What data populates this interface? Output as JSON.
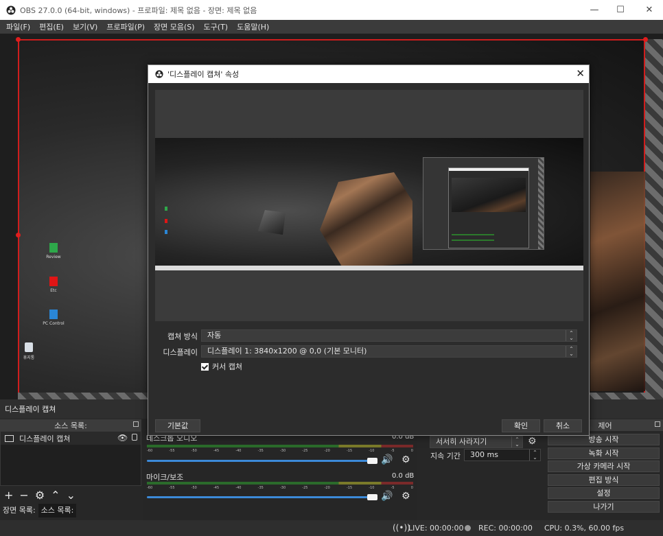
{
  "window": {
    "title": "OBS 27.0.0 (64-bit, windows) - 프로파일: 제목 없음 - 장면: 제목 없음",
    "minimize": "—",
    "maximize": "☐",
    "close": "✕"
  },
  "menu": [
    "파일(F)",
    "편집(E)",
    "보기(V)",
    "프로파일(P)",
    "장면 모음(S)",
    "도구(T)",
    "도움말(H)"
  ],
  "desktop_icons": [
    "Review",
    "Etc",
    "PC Control",
    "휴지통"
  ],
  "scene_title": "디스플레이 캡쳐",
  "sources": {
    "header": "소스 목록:",
    "items": [
      {
        "label": "디스플레이 캡쳐"
      }
    ],
    "tabs": [
      "장면 목록:",
      "소스 목록:"
    ]
  },
  "mixer": {
    "tracks": [
      {
        "name": "데스크톱 오디오",
        "db": "0.0 dB"
      },
      {
        "name": "마이크/보조",
        "db": "0.0 dB"
      }
    ],
    "ticks": [
      "-60",
      "-55",
      "-50",
      "-45",
      "-40",
      "-35",
      "-30",
      "-25",
      "-20",
      "-15",
      "-10",
      "-5",
      "0"
    ]
  },
  "transition": {
    "selected": "서서히 사라지기",
    "duration_label": "지속 기간",
    "duration_value": "300 ms"
  },
  "controls": {
    "header": "제어",
    "buttons": [
      "방송 시작",
      "녹화 시작",
      "가상 카메라 시작",
      "편집 방식",
      "설정",
      "나가기"
    ]
  },
  "status": {
    "live": "LIVE: 00:00:00",
    "rec": "REC: 00:00:00",
    "cpu": "CPU: 0.3%, 60.00 fps"
  },
  "dialog": {
    "title": "'디스플레이 캡쳐' 속성",
    "capture_method_label": "캡쳐 방식",
    "capture_method_value": "자동",
    "display_label": "디스플레이",
    "display_value": "디스플레이 1: 3840x1200 @ 0,0 (기본 모니터)",
    "cursor_label": "커서 캡쳐",
    "cursor_checked": true,
    "defaults_button": "기본값",
    "ok_button": "확인",
    "cancel_button": "취소"
  },
  "colors": {
    "selection_red": "#d01d1d",
    "slider_blue": "#3c8ad9",
    "meter_green": "#2b6b2b"
  }
}
